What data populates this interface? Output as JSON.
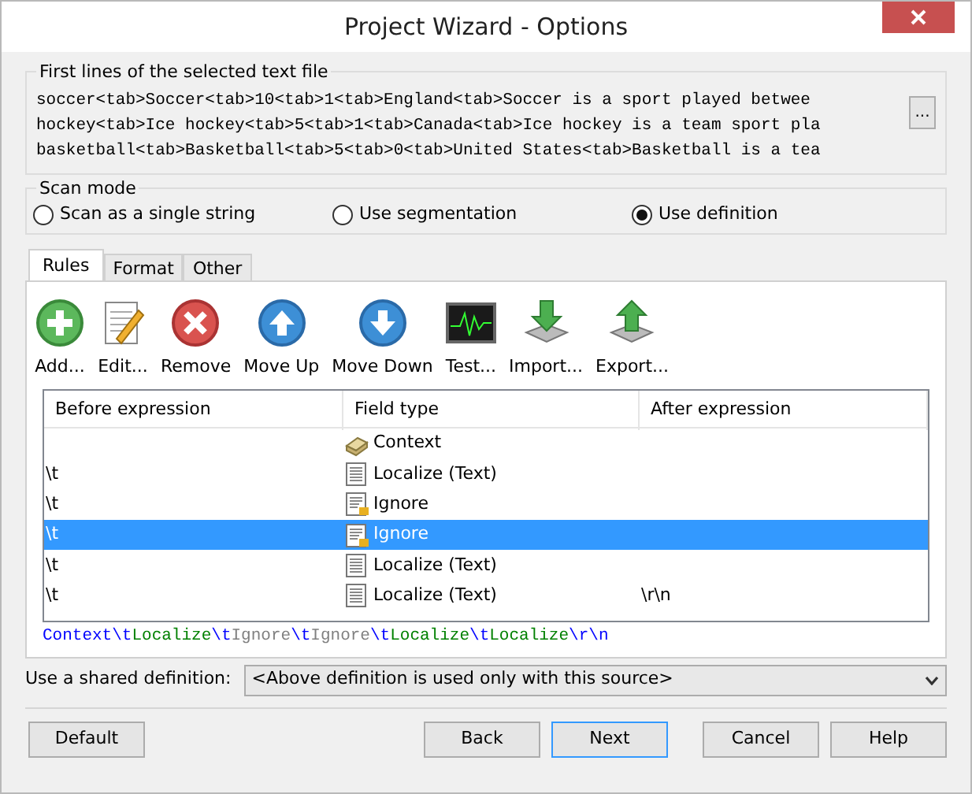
{
  "window": {
    "title": "Project Wizard - Options"
  },
  "preview": {
    "legend": "First lines of the selected text file",
    "lines": [
      "soccer<tab>Soccer<tab>10<tab>1<tab>England<tab>Soccer is a sport played betwee",
      "hockey<tab>Ice hockey<tab>5<tab>1<tab>Canada<tab>Ice hockey is a team sport pla",
      "basketball<tab>Basketball<tab>5<tab>0<tab>United States<tab>Basketball is a tea"
    ],
    "browse_button": "..."
  },
  "scan_mode": {
    "legend": "Scan mode",
    "options": [
      {
        "label": "Scan as a single string",
        "selected": false
      },
      {
        "label": "Use segmentation",
        "selected": false
      },
      {
        "label": "Use definition",
        "selected": true
      }
    ]
  },
  "tabs": [
    {
      "label": "Rules",
      "selected": true
    },
    {
      "label": "Format",
      "selected": false
    },
    {
      "label": "Other",
      "selected": false
    }
  ],
  "toolbar": [
    {
      "label": "Add...",
      "kind": "add"
    },
    {
      "label": "Edit...",
      "kind": "edit"
    },
    {
      "label": "Remove",
      "kind": "remove"
    },
    {
      "label": "Move Up",
      "kind": "up"
    },
    {
      "label": "Move Down",
      "kind": "down"
    },
    {
      "label": "Test...",
      "kind": "test"
    },
    {
      "label": "Import...",
      "kind": "import"
    },
    {
      "label": "Export...",
      "kind": "export"
    }
  ],
  "table": {
    "columns": [
      "Before expression",
      "Field type",
      "After expression"
    ],
    "rows": [
      {
        "before": "",
        "field_type": "Context",
        "kind": "context",
        "after": "",
        "selected": false
      },
      {
        "before": "\\t",
        "field_type": "Localize (Text)",
        "kind": "localize",
        "after": "",
        "selected": false
      },
      {
        "before": "\\t",
        "field_type": "Ignore",
        "kind": "ignore",
        "after": "",
        "selected": false
      },
      {
        "before": "\\t",
        "field_type": "Ignore",
        "kind": "ignore",
        "after": "",
        "selected": true
      },
      {
        "before": "\\t",
        "field_type": "Localize (Text)",
        "kind": "localize",
        "after": "",
        "selected": false
      },
      {
        "before": "\\t",
        "field_type": "Localize (Text)",
        "kind": "localize",
        "after": "\\r\\n",
        "selected": false
      }
    ]
  },
  "summary": [
    {
      "text": "Context",
      "color": "#0000ff"
    },
    {
      "text": "\\t",
      "color": "#0000ff"
    },
    {
      "text": "Localize",
      "color": "#008000"
    },
    {
      "text": "\\t",
      "color": "#0000ff"
    },
    {
      "text": "Ignore",
      "color": "#808080"
    },
    {
      "text": "\\t",
      "color": "#0000ff"
    },
    {
      "text": "Ignore",
      "color": "#808080"
    },
    {
      "text": "\\t",
      "color": "#0000ff"
    },
    {
      "text": "Localize",
      "color": "#008000"
    },
    {
      "text": "\\t",
      "color": "#0000ff"
    },
    {
      "text": "Localize",
      "color": "#008000"
    },
    {
      "text": "\\r\\n",
      "color": "#0000ff"
    }
  ],
  "shared_definition": {
    "label": "Use a shared definition:",
    "value": "<Above definition is used only with this source>"
  },
  "buttons": [
    {
      "label": "Default",
      "kind": "left",
      "default": false
    },
    {
      "label": "Back",
      "kind": "right",
      "default": false
    },
    {
      "label": "Next",
      "kind": "right",
      "default": true
    },
    {
      "label": "Cancel",
      "kind": "gap",
      "default": false
    },
    {
      "label": "Help",
      "kind": "right",
      "default": false
    }
  ]
}
